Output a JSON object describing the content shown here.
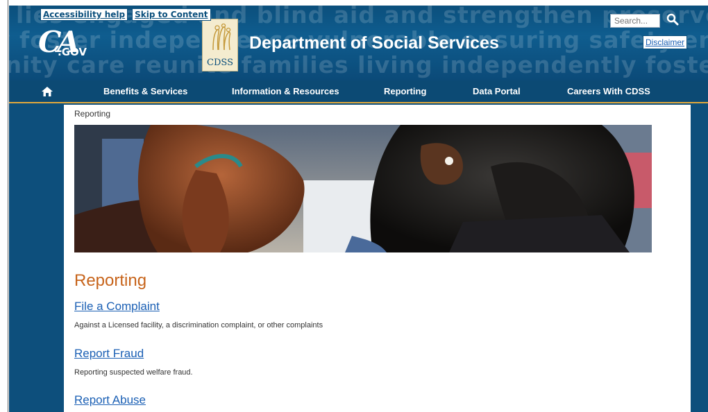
{
  "header": {
    "background_words": [
      "lies engaged and blind aid and strengthen preserve families",
      "y foster independence vulnerable ensuring safety ensuring safety",
      "unity care reunite families living independently foster children"
    ],
    "skip_links": [
      "Accessibility help",
      "Skip to Content"
    ],
    "ca_logo": {
      "mark": "CA",
      "suffix": ".GOV"
    },
    "cdss_logo_text": "CDSS",
    "title": "Department of Social Services",
    "search_placeholder": "Search...",
    "disclaimer": "Disclaimer"
  },
  "nav": {
    "home_icon": "home-icon",
    "items": [
      "Benefits & Services",
      "Information & Resources",
      "Reporting",
      "Data Portal",
      "Careers With CDSS"
    ]
  },
  "content": {
    "breadcrumb": "Reporting",
    "page_title": "Reporting",
    "links": [
      {
        "title": "File a Complaint",
        "desc": "Against a Licensed facility, a discrimination complaint, or other complaints"
      },
      {
        "title": "Report Fraud",
        "desc": "Reporting suspected welfare fraud."
      },
      {
        "title": "Report Abuse",
        "desc": ""
      }
    ]
  },
  "colors": {
    "header_blue": "#0b4f7c",
    "nav_accent": "#e2a93b",
    "title_orange": "#c7641b",
    "link_blue": "#1a5fb4"
  }
}
